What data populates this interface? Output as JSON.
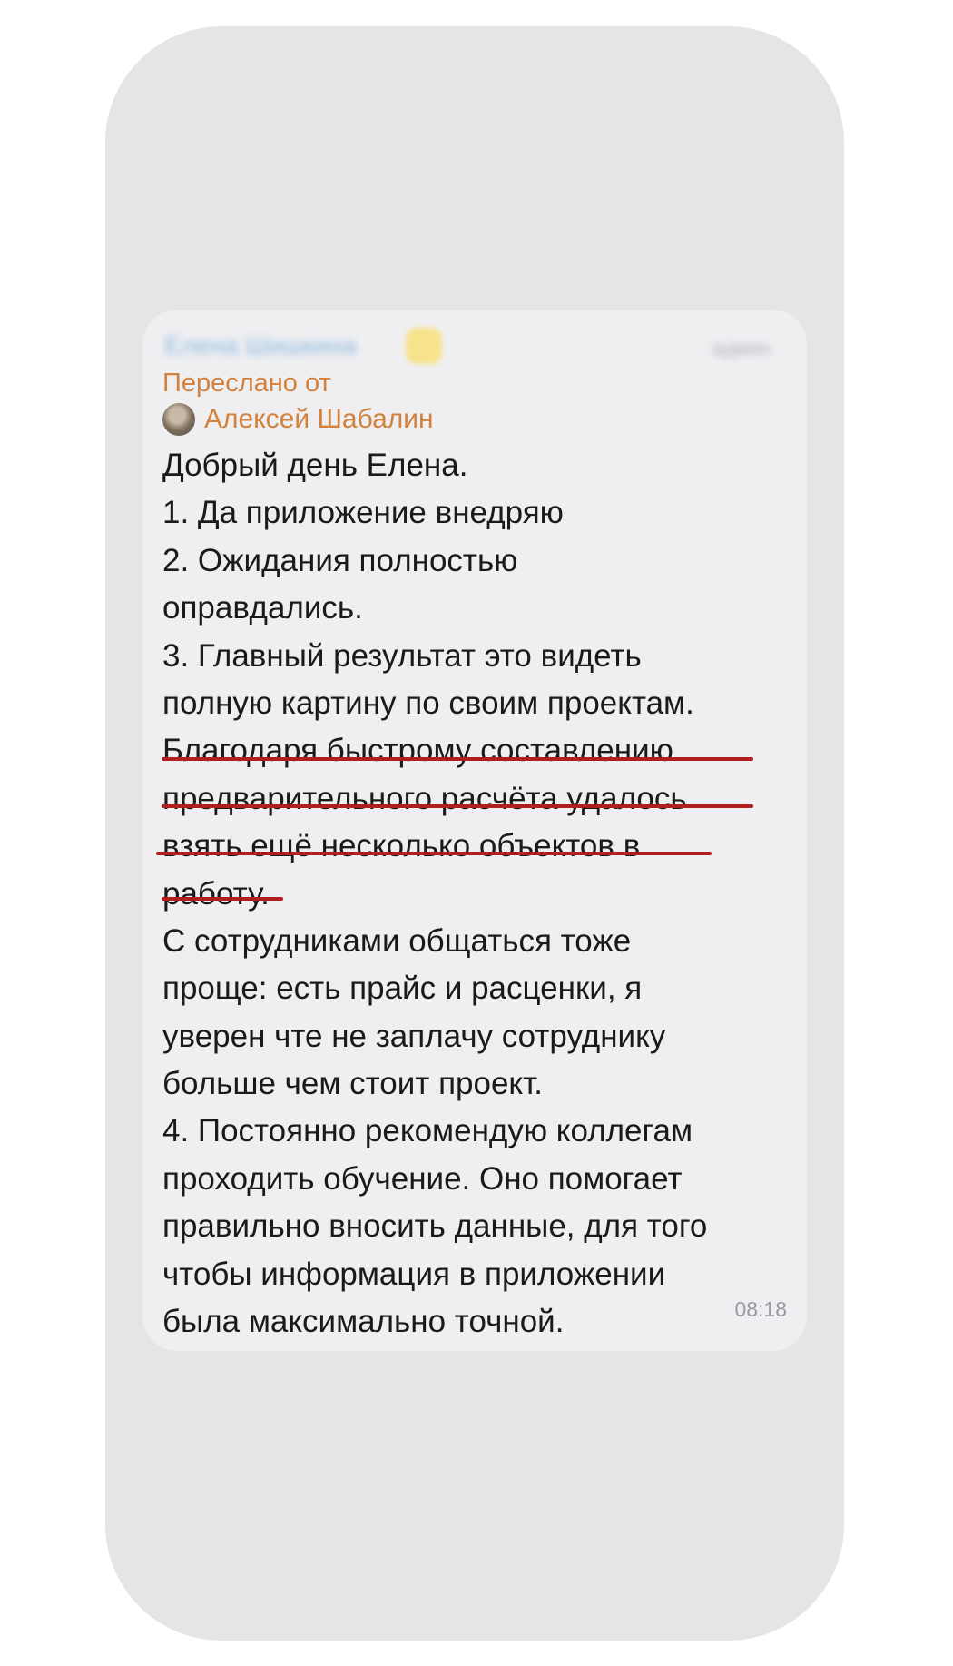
{
  "message": {
    "forwarded_label": "Переслано от",
    "forwarded_author": "Алексей Шабалин",
    "lines": [
      "Добрый день Елена.",
      "1. Да приложение внедряю",
      "2. Ожидания полностью",
      "оправдались.",
      "3. Главный результат это видеть",
      "полную картину по своим проектам.",
      "Благодаря быстрому составлению",
      "предварительного расчёта удалось",
      "взять ещё несколько объектов в",
      "работу.",
      "С сотрудниками общаться тоже",
      "проще: есть прайс и расценки, я",
      "уверен чте не заплачу сотруднику",
      "больше чем стоит проект.",
      "4. Постоянно рекомендую коллегам",
      "проходить обучение. Оно помогает",
      "правильно вносить данные, для того",
      "чтобы информация в приложении",
      "была максимально точной."
    ],
    "time": "08:18"
  },
  "colors": {
    "forward_accent": "#d2823c",
    "underline": "#b01e1e",
    "bubble_bg": "#efeff2",
    "phone_bg": "#e5e5e7"
  }
}
